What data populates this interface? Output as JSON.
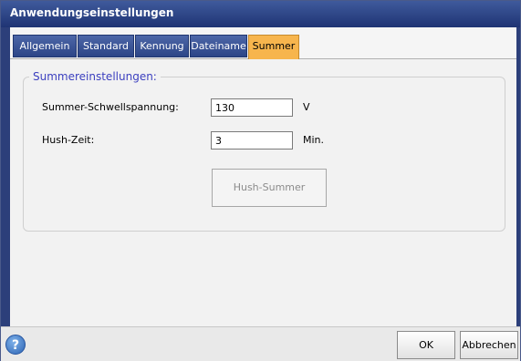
{
  "window": {
    "title": "Anwendungseinstellungen"
  },
  "tabs": [
    {
      "label": "Allgemein"
    },
    {
      "label": "Standard"
    },
    {
      "label": "Kennung"
    },
    {
      "label": "Dateiname"
    },
    {
      "label": "Summer",
      "active": true
    }
  ],
  "group": {
    "title": "Summereinstellungen:",
    "threshold": {
      "label": "Summer-Schwellspannung:",
      "value": "130",
      "unit": "V"
    },
    "hush_time": {
      "label": "Hush-Zeit:",
      "value": "3",
      "unit": "Min."
    },
    "hush_button": "Hush-Summer"
  },
  "footer": {
    "ok_label": "OK",
    "cancel_label": "Abbrechen",
    "help_icon": "help-icon",
    "help_glyph": "?"
  },
  "colors": {
    "titlebar": "#2c4587",
    "active_tab": "#f7b54d",
    "group_title": "#3b3fbf"
  }
}
